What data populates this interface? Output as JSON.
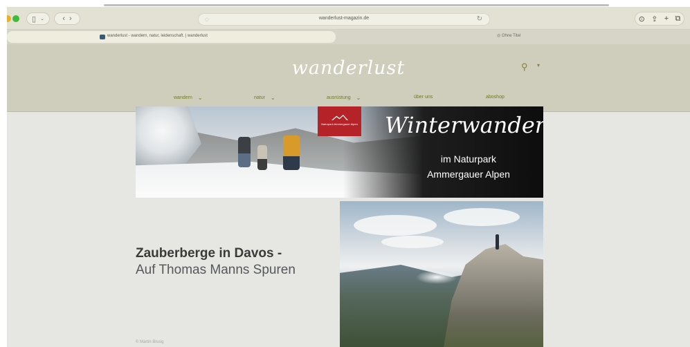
{
  "browser": {
    "url": "wanderlust-magazin.de",
    "tabs": [
      {
        "title": "wanderlust - wandern, natur, leidenschaft. | wanderlust",
        "active": true
      },
      {
        "title": "Ohne Titel",
        "active": false
      }
    ],
    "icons": {
      "sidebar": "sidebar-icon",
      "back": "chevron-left-icon",
      "forward": "chevron-right-icon",
      "shield": "shield-icon",
      "reload": "reload-icon",
      "download": "download-icon",
      "share": "share-icon",
      "new_tab": "plus-icon",
      "tab_overview": "tabs-icon"
    }
  },
  "site": {
    "logo": "wanderlust",
    "nav": [
      {
        "label": "wandern",
        "has_dropdown": true
      },
      {
        "label": "natur",
        "has_dropdown": true
      },
      {
        "label": "ausrüstung",
        "has_dropdown": true
      },
      {
        "label": "über uns",
        "has_dropdown": false
      },
      {
        "label": "aboshop",
        "has_dropdown": false
      }
    ],
    "accent_color": "#6f7a24",
    "header_color": "#cfcdbb"
  },
  "banner": {
    "logo_text": "Naturpark Ammergauer Alpen",
    "title": "Winterwandern",
    "subtitle_line1": "im Naturpark",
    "subtitle_line2": "Ammergauer Alpen"
  },
  "article": {
    "headline": "Zauberberge in Davos -",
    "subline": "Auf Thomas Manns Spuren",
    "photo_credit": "© Martin Bissig"
  }
}
